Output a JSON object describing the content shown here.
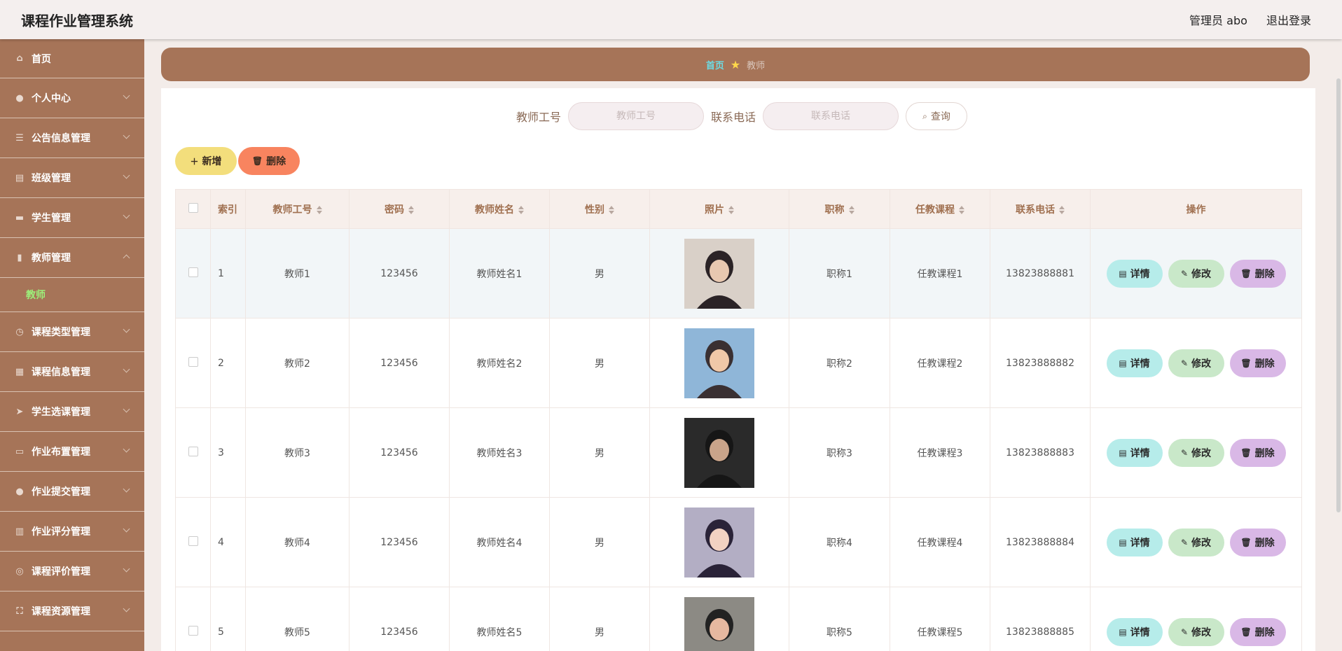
{
  "header": {
    "app_title": "课程作业管理系统",
    "user_label": "管理员 abo",
    "logout": "退出登录"
  },
  "sidebar": {
    "items": [
      {
        "label": "首页",
        "icon": "home-icon"
      },
      {
        "label": "个人中心",
        "icon": "user-icon"
      },
      {
        "label": "公告信息管理",
        "icon": "list-icon"
      },
      {
        "label": "班级管理",
        "icon": "clipboard-icon"
      },
      {
        "label": "学生管理",
        "icon": "chat-icon"
      },
      {
        "label": "教师管理",
        "icon": "bar-chart-icon"
      },
      {
        "label": "课程类型管理",
        "icon": "clock-icon"
      },
      {
        "label": "课程信息管理",
        "icon": "grid-icon"
      },
      {
        "label": "学生选课管理",
        "icon": "send-icon"
      },
      {
        "label": "作业布置管理",
        "icon": "monitor-icon"
      },
      {
        "label": "作业提交管理",
        "icon": "user-icon"
      },
      {
        "label": "作业评分管理",
        "icon": "calendar-icon"
      },
      {
        "label": "课程评价管理",
        "icon": "target-icon"
      },
      {
        "label": "课程资源管理",
        "icon": "fullscreen-icon"
      }
    ],
    "active_sub": "教师"
  },
  "breadcrumb": {
    "home": "首页",
    "current": "教师"
  },
  "search": {
    "teacher_id_label": "教师工号",
    "teacher_id_placeholder": "教师工号",
    "phone_label": "联系电话",
    "phone_placeholder": "联系电话",
    "query_button": "查询"
  },
  "actions": {
    "add": "新增",
    "delete": "删除"
  },
  "table": {
    "headers": [
      "索引",
      "教师工号",
      "密码",
      "教师姓名",
      "性别",
      "照片",
      "职称",
      "任教课程",
      "联系电话",
      "操作"
    ],
    "rows": [
      {
        "index": "1",
        "teacher_id": "教师1",
        "password": "123456",
        "name": "教师姓名1",
        "gender": "男",
        "title": "职称1",
        "course": "任教课程1",
        "phone": "13823888881"
      },
      {
        "index": "2",
        "teacher_id": "教师2",
        "password": "123456",
        "name": "教师姓名2",
        "gender": "男",
        "title": "职称2",
        "course": "任教课程2",
        "phone": "13823888882"
      },
      {
        "index": "3",
        "teacher_id": "教师3",
        "password": "123456",
        "name": "教师姓名3",
        "gender": "男",
        "title": "职称3",
        "course": "任教课程3",
        "phone": "13823888883"
      },
      {
        "index": "4",
        "teacher_id": "教师4",
        "password": "123456",
        "name": "教师姓名4",
        "gender": "男",
        "title": "职称4",
        "course": "任教课程4",
        "phone": "13823888884"
      },
      {
        "index": "5",
        "teacher_id": "教师5",
        "password": "123456",
        "name": "教师姓名5",
        "gender": "男",
        "title": "职称5",
        "course": "任教课程5",
        "phone": "13823888885"
      }
    ],
    "row_buttons": {
      "detail": "详情",
      "edit": "修改",
      "delete": "删除"
    }
  }
}
